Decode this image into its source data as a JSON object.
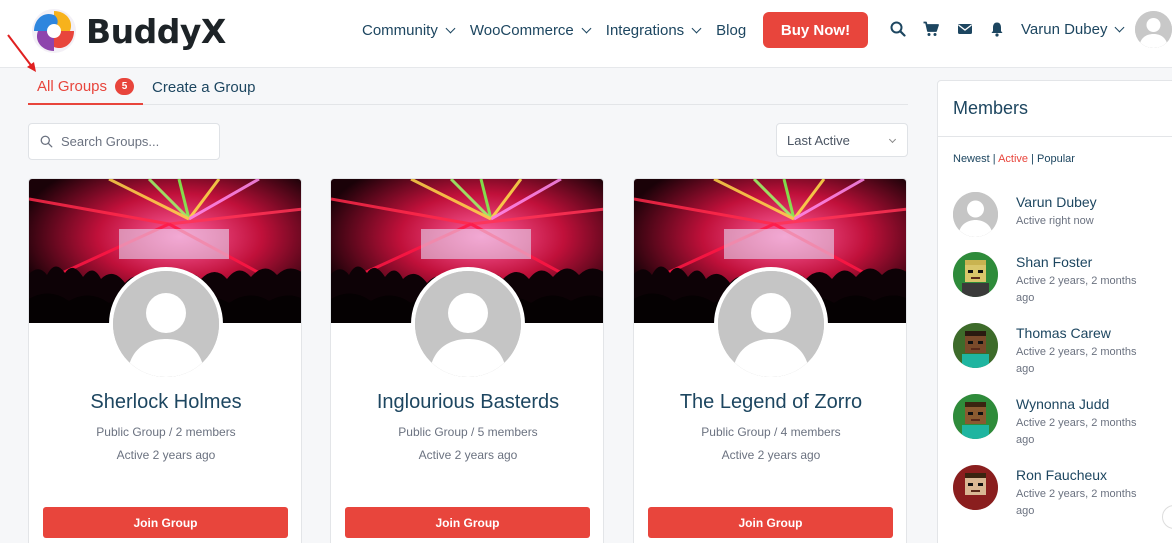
{
  "header": {
    "logo_text": "BuddyX",
    "nav": [
      {
        "label": "Community",
        "has_dropdown": true
      },
      {
        "label": "WooCommerce",
        "has_dropdown": true
      },
      {
        "label": "Integrations",
        "has_dropdown": true
      },
      {
        "label": "Blog",
        "has_dropdown": false
      }
    ],
    "buy_label": "Buy Now!",
    "icons": [
      "search-icon",
      "cart-icon",
      "mail-icon",
      "bell-icon"
    ],
    "user_name": "Varun Dubey"
  },
  "tabs": {
    "all_groups": "All Groups",
    "all_groups_count": "5",
    "create_group": "Create a Group"
  },
  "search": {
    "placeholder": "Search Groups..."
  },
  "sort": {
    "selected": "Last Active"
  },
  "groups": [
    {
      "name": "Sherlock Holmes",
      "meta": "Public Group / 2 members",
      "active": "Active 2 years ago",
      "button": "Join Group"
    },
    {
      "name": "Inglourious Basterds",
      "meta": "Public Group / 5 members",
      "active": "Active 2 years ago",
      "button": "Join Group"
    },
    {
      "name": "The Legend of Zorro",
      "meta": "Public Group / 4 members",
      "active": "Active 2 years ago",
      "button": "Join Group"
    }
  ],
  "members_widget": {
    "title": "Members",
    "filters": {
      "newest": "Newest",
      "active": "Active",
      "popular": "Popular",
      "sep": "|"
    },
    "members": [
      {
        "name": "Varun Dubey",
        "status": "Active right now"
      },
      {
        "name": "Shan Foster",
        "status": "Active 2 years, 2 months ago"
      },
      {
        "name": "Thomas Carew",
        "status": "Active 2 years, 2 months ago"
      },
      {
        "name": "Wynonna Judd",
        "status": "Active 2 years, 2 months ago"
      },
      {
        "name": "Ron Faucheux",
        "status": "Active 2 years, 2 months ago"
      }
    ]
  },
  "colors": {
    "accent": "#e8453c",
    "text": "#1d4660",
    "muted": "#6b7280"
  }
}
